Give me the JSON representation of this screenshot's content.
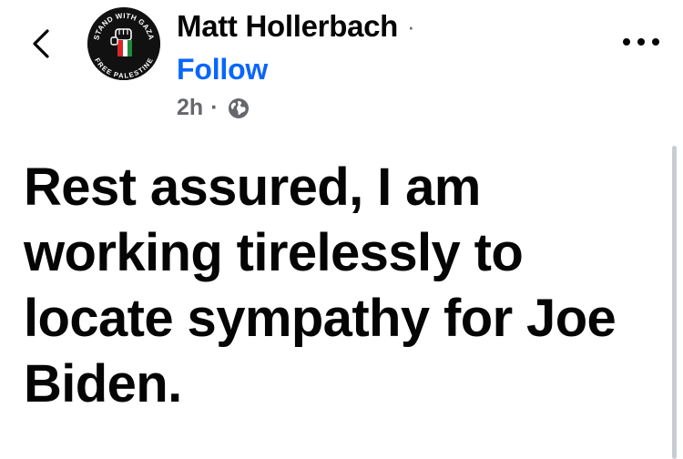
{
  "header": {
    "back_icon": "chevron-left-icon",
    "author": {
      "name": "Matt Hollerbach",
      "name_separator": "·",
      "avatar": {
        "icon": "raised-fist-icon",
        "ring_text_top": "STAND WITH GAZA",
        "ring_text_bottom": "FREE PALESTINE",
        "colors": {
          "background": "#111111",
          "ring_text": "#ffffff",
          "flag_red": "#d62828",
          "flag_green": "#1f8a3a",
          "flag_white": "#ffffff"
        }
      }
    },
    "follow_label": "Follow",
    "timestamp": "2h",
    "meta_separator": "·",
    "audience_icon": "globe-icon",
    "more_icon": "more-options-icon"
  },
  "post": {
    "text": "Rest assured, I am working tirelessly to locate sympathy for Joe Biden."
  },
  "colors": {
    "link_blue": "#0866ff",
    "text": "#050505",
    "muted": "#65676b"
  }
}
